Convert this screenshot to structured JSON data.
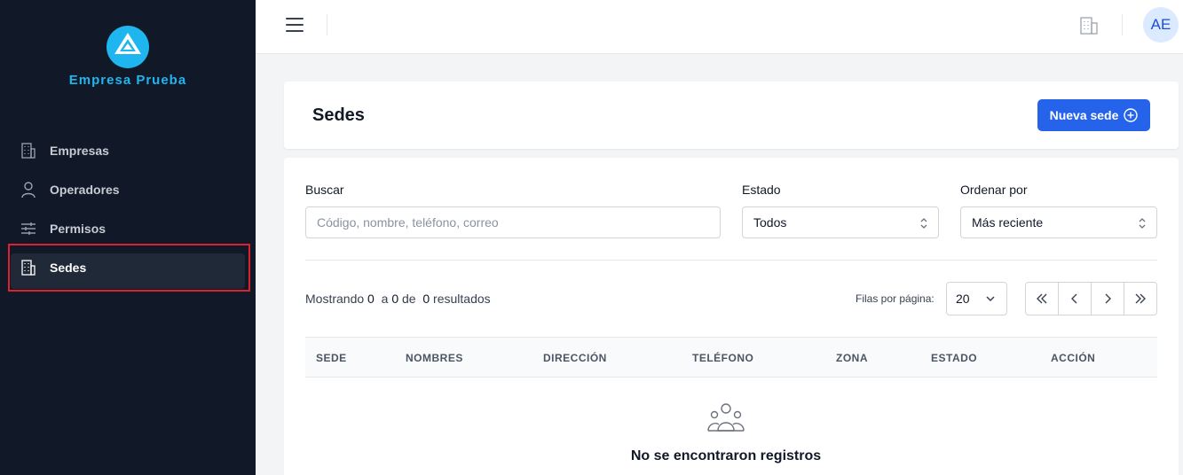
{
  "brand": {
    "name": "Empresa Prueba",
    "logo_icon": "triangle-logo-icon",
    "color": "#1fb6ef"
  },
  "sidebar": {
    "items": [
      {
        "label": "Empresas",
        "icon": "building-icon"
      },
      {
        "label": "Operadores",
        "icon": "user-icon"
      },
      {
        "label": "Permisos",
        "icon": "sliders-icon"
      },
      {
        "label": "Sedes",
        "icon": "building-icon",
        "active": true
      }
    ]
  },
  "topbar": {
    "avatar_initials": "AE"
  },
  "page": {
    "title": "Sedes",
    "new_button_label": "Nueva sede"
  },
  "filters": {
    "search_label": "Buscar",
    "search_placeholder": "Código, nombre, teléfono, correo",
    "status_label": "Estado",
    "status_value": "Todos",
    "order_label": "Ordenar por",
    "order_value": "Más reciente"
  },
  "results": {
    "showing_prefix": "Mostrando",
    "from": "0",
    "to_word": "a",
    "to": "0",
    "of_word": "de",
    "total": "0",
    "results_word": "resultados",
    "rows_label": "Filas por página:",
    "rows_value": "20"
  },
  "table": {
    "columns": [
      "SEDE",
      "NOMBRES",
      "DIRECCIÓN",
      "TELÉFONO",
      "ZONA",
      "ESTADO",
      "ACCIÓN"
    ],
    "empty_message": "No se encontraron registros"
  },
  "colors": {
    "sidebar_bg": "#111827",
    "primary": "#2563eb",
    "highlight": "#e0202c"
  }
}
